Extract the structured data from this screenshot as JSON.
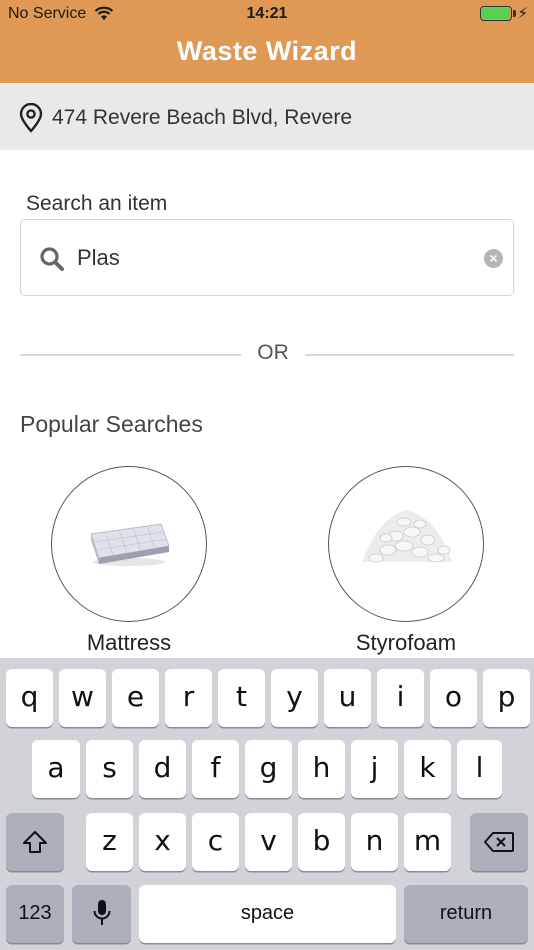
{
  "status_bar": {
    "carrier": "No Service",
    "time": "14:21",
    "battery_level": 1.0
  },
  "header": {
    "title": "Waste Wizard",
    "background_color": "#df9955"
  },
  "address": {
    "text": "474 Revere Beach Blvd, Revere"
  },
  "search": {
    "label": "Search an item",
    "value": "Plas"
  },
  "divider": {
    "text": "OR"
  },
  "popular": {
    "title": "Popular Searches",
    "items": [
      {
        "label": "Mattress",
        "icon": "mattress-image"
      },
      {
        "label": "Styrofoam",
        "icon": "styrofoam-image"
      }
    ]
  },
  "keyboard": {
    "row1": [
      "q",
      "w",
      "e",
      "r",
      "t",
      "y",
      "u",
      "i",
      "o",
      "p"
    ],
    "row2": [
      "a",
      "s",
      "d",
      "f",
      "g",
      "h",
      "j",
      "k",
      "l"
    ],
    "row3": [
      "z",
      "x",
      "c",
      "v",
      "b",
      "n",
      "m"
    ],
    "numbers_label": "123",
    "space_label": "space",
    "return_label": "return",
    "shift_icon": "shift-icon",
    "delete_icon": "delete-icon",
    "mic_icon": "microphone-icon"
  }
}
